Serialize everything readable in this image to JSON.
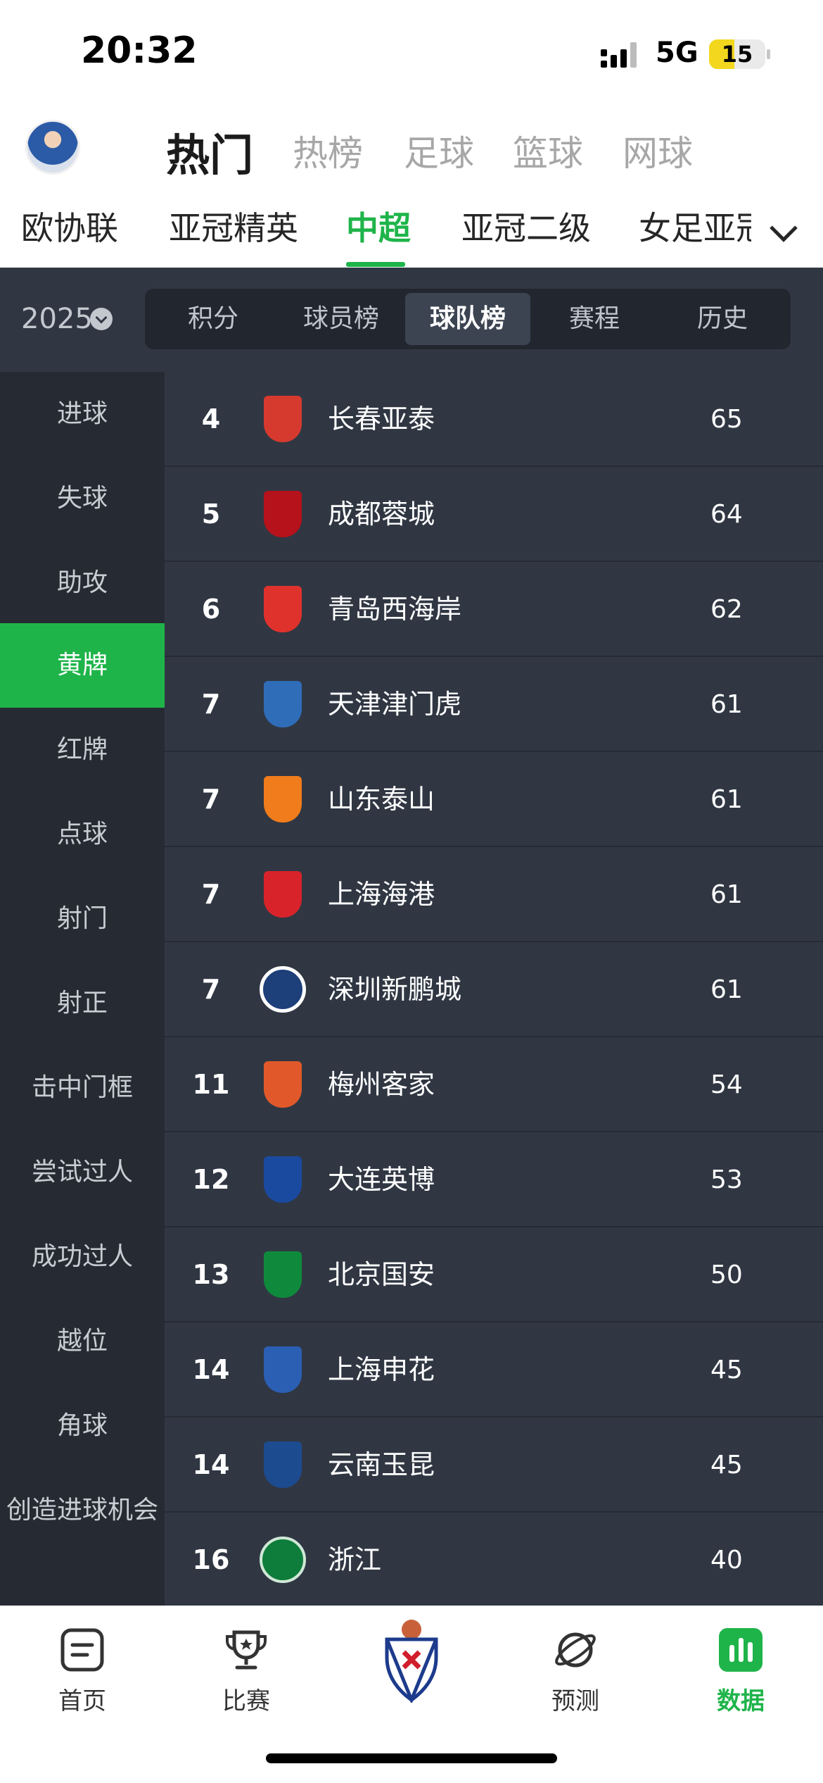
{
  "status": {
    "time": "20:32",
    "network": "5G",
    "battery": "15"
  },
  "header": {
    "tabs": [
      {
        "label": "热门",
        "active": true
      },
      {
        "label": "热榜"
      },
      {
        "label": "足球"
      },
      {
        "label": "篮球"
      },
      {
        "label": "网球"
      }
    ]
  },
  "leagues": {
    "items": [
      {
        "label": "欧协联"
      },
      {
        "label": "亚冠精英"
      },
      {
        "label": "中超",
        "active": true
      },
      {
        "label": "亚冠二级"
      },
      {
        "label": "女足亚冠"
      }
    ]
  },
  "season": {
    "label": "2025"
  },
  "segments": {
    "items": [
      {
        "label": "积分"
      },
      {
        "label": "球员榜"
      },
      {
        "label": "球队榜",
        "active": true
      },
      {
        "label": "赛程"
      },
      {
        "label": "历史"
      }
    ]
  },
  "categories": [
    "进球",
    "失球",
    "助攻",
    "黄牌",
    "红牌",
    "点球",
    "射门",
    "射正",
    "击中门框",
    "尝试过人",
    "成功过人",
    "越位",
    "角球",
    "创造进球机会"
  ],
  "active_category": "黄牌",
  "table": {
    "rows": [
      {
        "rank": "4",
        "team": "长春亚泰",
        "value": "65",
        "color": "#d63a2f"
      },
      {
        "rank": "5",
        "team": "成都蓉城",
        "value": "64",
        "color": "#b5121b"
      },
      {
        "rank": "6",
        "team": "青岛西海岸",
        "value": "62",
        "color": "#e0322c"
      },
      {
        "rank": "7",
        "team": "天津津门虎",
        "value": "61",
        "color": "#2f6db8"
      },
      {
        "rank": "7",
        "team": "山东泰山",
        "value": "61",
        "color": "#f07c1c"
      },
      {
        "rank": "7",
        "team": "上海海港",
        "value": "61",
        "color": "#d9232a"
      },
      {
        "rank": "7",
        "team": "深圳新鹏城",
        "value": "61",
        "color": "#1d3f7a"
      },
      {
        "rank": "11",
        "team": "梅州客家",
        "value": "54",
        "color": "#e1592a"
      },
      {
        "rank": "12",
        "team": "大连英博",
        "value": "53",
        "color": "#1a4aa0"
      },
      {
        "rank": "13",
        "team": "北京国安",
        "value": "50",
        "color": "#0f8a3c"
      },
      {
        "rank": "14",
        "team": "上海申花",
        "value": "45",
        "color": "#2b5fb3"
      },
      {
        "rank": "14",
        "team": "云南玉昆",
        "value": "45",
        "color": "#1d4b8f"
      },
      {
        "rank": "16",
        "team": "浙江",
        "value": "40",
        "color": "#0e7c3a"
      }
    ]
  },
  "bottom_nav": {
    "items": [
      {
        "label": "首页"
      },
      {
        "label": "比赛"
      },
      {
        "label": ""
      },
      {
        "label": "预测"
      },
      {
        "label": "数据",
        "active": true
      }
    ]
  },
  "colors": {
    "accent": "#1fb44a",
    "dark_bg": "#303743",
    "nav_bg": "#262b33"
  }
}
